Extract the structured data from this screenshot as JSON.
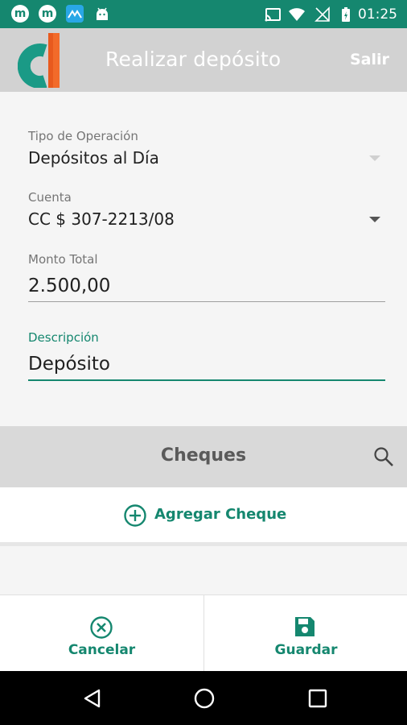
{
  "status_bar": {
    "left_icons": [
      "m-app-icon",
      "m-app-icon",
      "mountain-app-icon",
      "android-icon"
    ],
    "right_icons": [
      "cast-icon",
      "wifi-icon",
      "no-signal-icon",
      "battery-icon"
    ],
    "time": "01:25",
    "color": "#15876f"
  },
  "app_bar": {
    "title": "Realizar depósito",
    "exit_label": "Salir",
    "logo_icon": "app-logo-d",
    "background": "#d2d2d2"
  },
  "form": {
    "tipo_operacion": {
      "label": "Tipo de Operación",
      "value": "Depósitos al Día"
    },
    "cuenta": {
      "label": "Cuenta",
      "value": "CC $ 307-2213/08"
    },
    "monto_total": {
      "label": "Monto Total",
      "value": "2.500,00"
    },
    "descripcion": {
      "label": "Descripción",
      "value": "Depósito"
    }
  },
  "cheques": {
    "title": "Cheques",
    "search_icon": "search-icon",
    "add_label": "Agregar Cheque"
  },
  "actions": {
    "cancel_label": "Cancelar",
    "save_label": "Guardar"
  },
  "colors": {
    "accent": "#15876f",
    "logo_teal": "#1a9a86",
    "logo_orange": "#f26b2a"
  }
}
